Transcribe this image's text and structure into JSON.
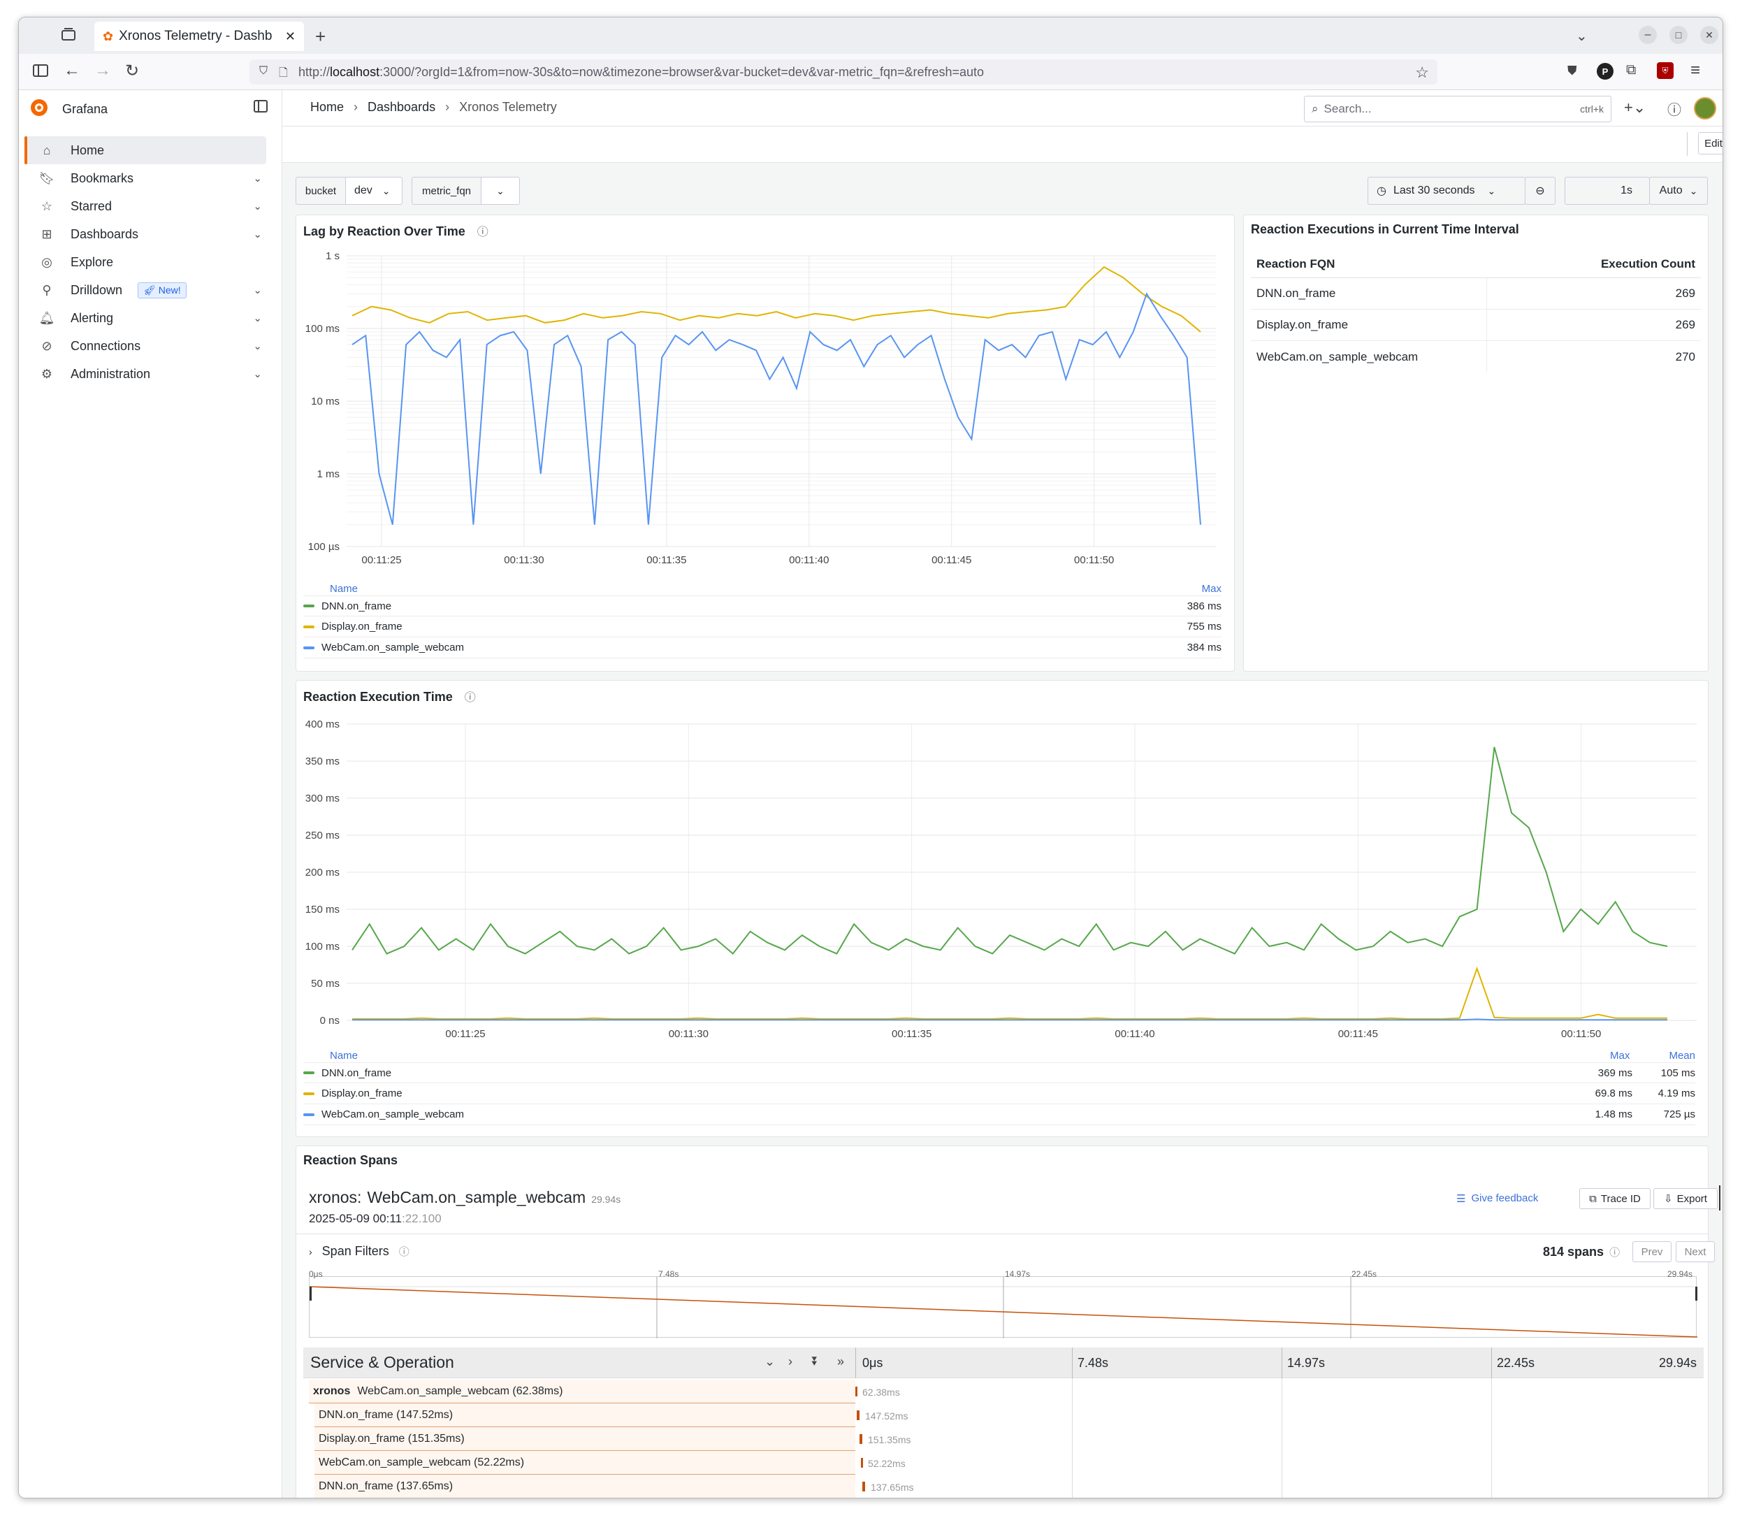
{
  "browser": {
    "tab_title": "Xronos Telemetry - Dashb",
    "url_prefix": "http://",
    "url_host": "localhost",
    "url_rest": ":3000/?orgId=1&from=now-30s&to=now&timezone=browser&var-bucket=dev&var-metric_fqn=&refresh=auto"
  },
  "sidebar": {
    "brand": "Grafana",
    "items": [
      {
        "label": "Home",
        "icon": "home-icon"
      },
      {
        "label": "Bookmarks",
        "icon": "bookmark-icon"
      },
      {
        "label": "Starred",
        "icon": "star-icon"
      },
      {
        "label": "Dashboards",
        "icon": "grid-icon"
      },
      {
        "label": "Explore",
        "icon": "compass-icon"
      },
      {
        "label": "Drilldown",
        "icon": "drilldown-icon",
        "badge": "New!"
      },
      {
        "label": "Alerting",
        "icon": "bell-icon"
      },
      {
        "label": "Connections",
        "icon": "plug-icon"
      },
      {
        "label": "Administration",
        "icon": "gear-icon"
      }
    ]
  },
  "topnav": {
    "breadcrumb": [
      "Home",
      "Dashboards",
      "Xronos Telemetry"
    ],
    "search_placeholder": "Search...",
    "search_shortcut": "ctrl+k",
    "edit_label": "Edit"
  },
  "vars": {
    "bucket_label": "bucket",
    "bucket_value": "dev",
    "metric_label": "metric_fqn",
    "metric_value": ""
  },
  "timepicker": {
    "range": "Last 30 seconds",
    "refresh_interval": "1s",
    "auto": "Auto"
  },
  "colors": {
    "green": "#56a64b",
    "yellow": "#e0b400",
    "blue": "#5794f2",
    "accent": "#3d71d9",
    "span_orange": "#c4510a"
  },
  "lag_panel": {
    "title": "Lag by Reaction Over Time",
    "legend_name": "Name",
    "legend_max": "Max",
    "legend": [
      {
        "name": "DNN.on_frame",
        "max": "386 ms"
      },
      {
        "name": "Display.on_frame",
        "max": "755 ms"
      },
      {
        "name": "WebCam.on_sample_webcam",
        "max": "384 ms"
      }
    ],
    "chart_data": {
      "type": "line",
      "yscale": "log",
      "yticks": [
        "1 s",
        "100 ms",
        "10 ms",
        "1 ms",
        "100 µs"
      ],
      "x": [
        "00:11:25",
        "00:11:30",
        "00:11:35",
        "00:11:40",
        "00:11:45",
        "00:11:50"
      ],
      "series": [
        {
          "name": "Display.on_frame",
          "color": "#e0b400",
          "values_ms": [
            150,
            200,
            180,
            140,
            120,
            160,
            170,
            130,
            140,
            150,
            120,
            130,
            160,
            140,
            150,
            170,
            160,
            130,
            150,
            140,
            160,
            150,
            170,
            140,
            160,
            150,
            130,
            150,
            160,
            170,
            180,
            160,
            150,
            140,
            160,
            170,
            180,
            200,
            400,
            700,
            500,
            300,
            200,
            150,
            90
          ]
        },
        {
          "name": "WebCam.on_sample_webcam",
          "color": "#5794f2",
          "values_ms": [
            60,
            80,
            1,
            0.2,
            60,
            90,
            50,
            40,
            70,
            0.2,
            60,
            80,
            90,
            50,
            1,
            60,
            80,
            30,
            0.2,
            70,
            90,
            60,
            0.2,
            40,
            80,
            60,
            90,
            50,
            70,
            60,
            50,
            20,
            40,
            15,
            90,
            60,
            50,
            70,
            30,
            60,
            80,
            40,
            60,
            80,
            20,
            6,
            3,
            70,
            50,
            60,
            40,
            80,
            90,
            20,
            70,
            60,
            90,
            40,
            90,
            300,
            150,
            80,
            40,
            0.2
          ]
        }
      ]
    }
  },
  "exec_table": {
    "title": "Reaction Executions in Current Time Interval",
    "col_fqn": "Reaction FQN",
    "col_count": "Execution Count",
    "rows": [
      {
        "fqn": "DNN.on_frame",
        "count": "269"
      },
      {
        "fqn": "Display.on_frame",
        "count": "269"
      },
      {
        "fqn": "WebCam.on_sample_webcam",
        "count": "270"
      }
    ]
  },
  "exec_panel": {
    "title": "Reaction Execution Time",
    "legend_name": "Name",
    "legend_max": "Max",
    "legend_mean": "Mean",
    "legend": [
      {
        "name": "DNN.on_frame",
        "max": "369 ms",
        "mean": "105 ms"
      },
      {
        "name": "Display.on_frame",
        "max": "69.8 ms",
        "mean": "4.19 ms"
      },
      {
        "name": "WebCam.on_sample_webcam",
        "max": "1.48 ms",
        "mean": "725 µs"
      }
    ],
    "chart_data": {
      "type": "line",
      "yticks": [
        "400 ms",
        "350 ms",
        "300 ms",
        "250 ms",
        "200 ms",
        "150 ms",
        "100 ms",
        "50 ms",
        "0 ns"
      ],
      "ylim": [
        0,
        400
      ],
      "x": [
        "00:11:25",
        "00:11:30",
        "00:11:35",
        "00:11:40",
        "00:11:45",
        "00:11:50"
      ],
      "series": [
        {
          "name": "DNN.on_frame",
          "color": "#56a64b",
          "values_ms": [
            95,
            130,
            90,
            100,
            125,
            95,
            110,
            95,
            130,
            100,
            90,
            105,
            120,
            100,
            95,
            110,
            90,
            100,
            125,
            95,
            100,
            110,
            90,
            120,
            105,
            95,
            115,
            100,
            90,
            130,
            105,
            95,
            110,
            100,
            95,
            125,
            100,
            90,
            115,
            105,
            95,
            110,
            100,
            130,
            95,
            105,
            100,
            120,
            95,
            110,
            100,
            90,
            125,
            100,
            105,
            95,
            130,
            110,
            95,
            100,
            120,
            105,
            110,
            100,
            140,
            150,
            369,
            280,
            260,
            200,
            120,
            150,
            130,
            160,
            120,
            105,
            100
          ]
        },
        {
          "name": "Display.on_frame",
          "color": "#e0b400",
          "values_ms": [
            2,
            2,
            2,
            2,
            3,
            2,
            2,
            2,
            2,
            3,
            2,
            2,
            2,
            2,
            3,
            2,
            2,
            2,
            2,
            2,
            3,
            2,
            2,
            2,
            2,
            2,
            3,
            2,
            2,
            2,
            2,
            2,
            3,
            2,
            2,
            2,
            2,
            2,
            3,
            2,
            2,
            2,
            2,
            3,
            2,
            2,
            2,
            2,
            2,
            3,
            2,
            2,
            2,
            2,
            2,
            3,
            2,
            2,
            2,
            2,
            3,
            2,
            2,
            2,
            3,
            70,
            4,
            3,
            3,
            3,
            3,
            3,
            8,
            3,
            3,
            3,
            3
          ]
        },
        {
          "name": "WebCam.on_sample_webcam",
          "color": "#5794f2",
          "values_ms": [
            0.7,
            0.7,
            0.7,
            0.7,
            0.7,
            0.7,
            0.7,
            0.7,
            0.7,
            0.7,
            0.7,
            0.7,
            0.7,
            0.7,
            0.7,
            0.7,
            0.7,
            0.7,
            0.7,
            0.7,
            0.7,
            0.7,
            0.7,
            0.7,
            0.7,
            0.7,
            0.7,
            0.7,
            0.7,
            0.7,
            0.7,
            0.7,
            0.7,
            0.7,
            0.7,
            0.7,
            0.7,
            0.7,
            0.7,
            0.7,
            0.7,
            0.7,
            0.7,
            0.7,
            0.7,
            0.7,
            0.7,
            0.7,
            0.7,
            0.7,
            0.7,
            0.7,
            0.7,
            0.7,
            0.7,
            0.7,
            0.7,
            0.7,
            0.7,
            0.7,
            0.7,
            0.7,
            0.7,
            0.7,
            0.7,
            1.48,
            0.7,
            0.7,
            0.7,
            0.7,
            0.7,
            0.7,
            0.7,
            0.7,
            0.7,
            0.7,
            0.7
          ]
        }
      ]
    }
  },
  "spans_panel": {
    "title": "Reaction Spans",
    "trace_service": "xronos:",
    "trace_name": "WebCam.on_sample_webcam",
    "trace_duration": "29.94s",
    "trace_date_main": "2025-05-09 00:11",
    "trace_date_rest": ":22.100",
    "give_feedback": "Give feedback",
    "trace_id": "Trace ID",
    "export": "Export",
    "span_filters": "Span Filters",
    "span_count": "814 spans",
    "prev": "Prev",
    "next": "Next",
    "minimap_ticks": [
      "0μs",
      "7.48s",
      "14.97s",
      "22.45s",
      "29.94s"
    ],
    "header_service": "Service & Operation",
    "timeline_ticks": [
      "0μs",
      "7.48s",
      "14.97s",
      "22.45s",
      "29.94s"
    ],
    "spans": [
      {
        "service": "xronos",
        "op": "WebCam.on_sample_webcam (62.38ms)",
        "dur": "62.38ms"
      },
      {
        "service": "",
        "op": "DNN.on_frame (147.52ms)",
        "dur": "147.52ms"
      },
      {
        "service": "",
        "op": "Display.on_frame (151.35ms)",
        "dur": "151.35ms"
      },
      {
        "service": "",
        "op": "WebCam.on_sample_webcam (52.22ms)",
        "dur": "52.22ms"
      },
      {
        "service": "",
        "op": "DNN.on_frame (137.65ms)",
        "dur": "137.65ms"
      }
    ]
  }
}
